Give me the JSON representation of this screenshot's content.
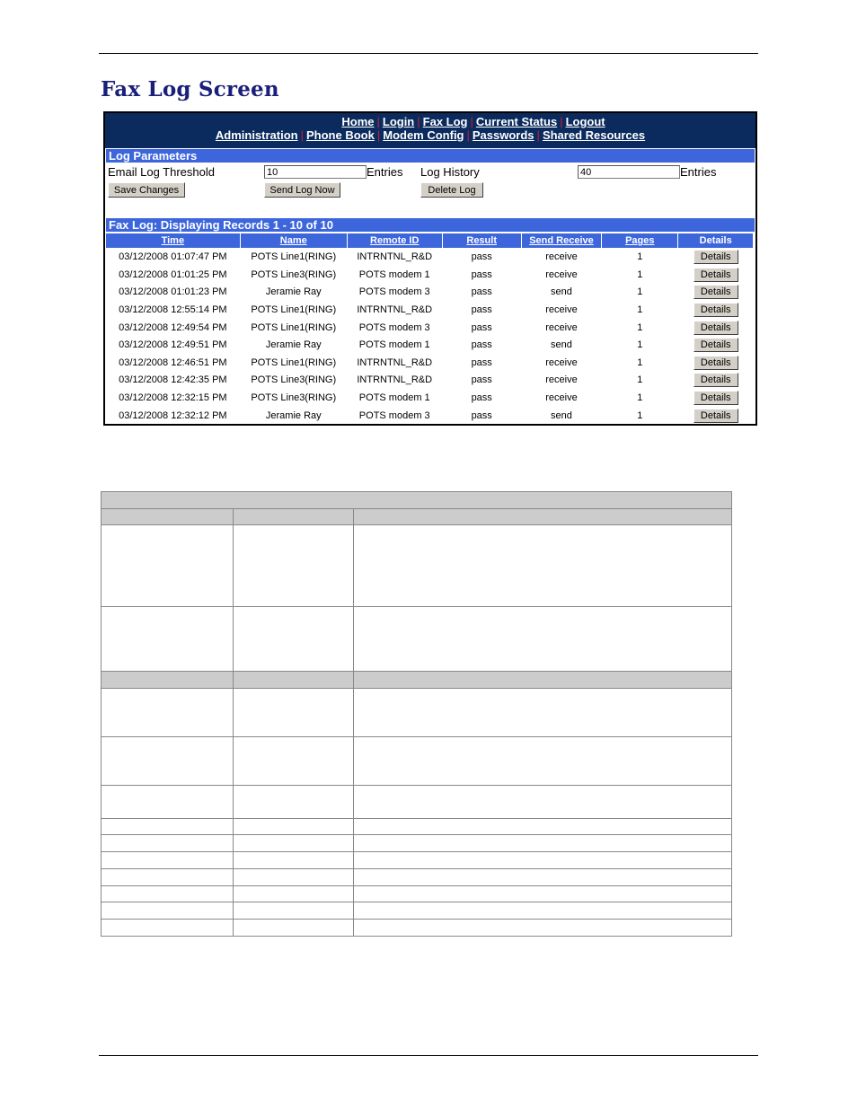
{
  "page_title": "Fax Log Screen",
  "nav": {
    "row1": [
      "Home",
      "Login",
      "Fax Log",
      "Current Status",
      "Logout"
    ],
    "row2": [
      "Administration",
      "Phone Book",
      "Modem Config",
      "Passwords",
      "Shared Resources"
    ],
    "separator": "|"
  },
  "log_parameters": {
    "section_title": "Log Parameters",
    "email_log_threshold_label": "Email Log Threshold",
    "email_log_threshold_value": "10",
    "entries_label_1": "Entries",
    "log_history_label": "Log History",
    "log_history_value": "40",
    "entries_label_2": "Entries",
    "save_changes_button": "Save Changes",
    "send_log_now_button": "Send Log Now",
    "delete_log_button": "Delete Log"
  },
  "fax_log": {
    "section_title": "Fax Log: Displaying Records 1 - 10 of 10",
    "columns": [
      "Time",
      "Name",
      "Remote ID",
      "Result",
      "Send Receive",
      "Pages",
      "Details"
    ],
    "rows": [
      {
        "time": "03/12/2008 01:07:47 PM",
        "name": "POTS Line1(RING)",
        "remote_id": "INTRNTNL_R&D",
        "result": "pass",
        "send_receive": "receive",
        "pages": "1",
        "details": "Details"
      },
      {
        "time": "03/12/2008 01:01:25 PM",
        "name": "POTS Line3(RING)",
        "remote_id": "POTS modem 1",
        "result": "pass",
        "send_receive": "receive",
        "pages": "1",
        "details": "Details"
      },
      {
        "time": "03/12/2008 01:01:23 PM",
        "name": "Jeramie Ray",
        "remote_id": "POTS modem 3",
        "result": "pass",
        "send_receive": "send",
        "pages": "1",
        "details": "Details"
      },
      {
        "time": "03/12/2008 12:55:14 PM",
        "name": "POTS Line1(RING)",
        "remote_id": "INTRNTNL_R&D",
        "result": "pass",
        "send_receive": "receive",
        "pages": "1",
        "details": "Details"
      },
      {
        "time": "03/12/2008 12:49:54 PM",
        "name": "POTS Line1(RING)",
        "remote_id": "POTS modem 3",
        "result": "pass",
        "send_receive": "receive",
        "pages": "1",
        "details": "Details"
      },
      {
        "time": "03/12/2008 12:49:51 PM",
        "name": "Jeramie Ray",
        "remote_id": "POTS modem 1",
        "result": "pass",
        "send_receive": "send",
        "pages": "1",
        "details": "Details"
      },
      {
        "time": "03/12/2008 12:46:51 PM",
        "name": "POTS Line1(RING)",
        "remote_id": "INTRNTNL_R&D",
        "result": "pass",
        "send_receive": "receive",
        "pages": "1",
        "details": "Details"
      },
      {
        "time": "03/12/2008 12:42:35 PM",
        "name": "POTS Line3(RING)",
        "remote_id": "INTRNTNL_R&D",
        "result": "pass",
        "send_receive": "receive",
        "pages": "1",
        "details": "Details"
      },
      {
        "time": "03/12/2008 12:32:15 PM",
        "name": "POTS Line3(RING)",
        "remote_id": "POTS modem 1",
        "result": "pass",
        "send_receive": "receive",
        "pages": "1",
        "details": "Details"
      },
      {
        "time": "03/12/2008 12:32:12 PM",
        "name": "Jeramie Ray",
        "remote_id": "POTS modem 3",
        "result": "pass",
        "send_receive": "send",
        "pages": "1",
        "details": "Details"
      }
    ]
  },
  "colors": {
    "nav_bg": "#0b2b5e",
    "section_bar": "#3d66dc",
    "nav_separator": "#c8203a",
    "title": "#1a1f7a",
    "doc_table_shade": "#cccccc"
  }
}
